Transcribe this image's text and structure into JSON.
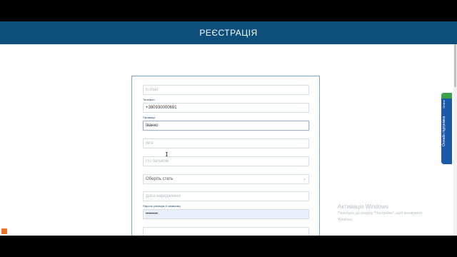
{
  "header": {
    "title": "РЕЄСТРАЦІЯ"
  },
  "form": {
    "email": {
      "placeholder": "E-mail",
      "value": ""
    },
    "phone": {
      "label": "Телефон",
      "value": "+380930000691"
    },
    "surname": {
      "label": "Прізвище",
      "value": "Іванко"
    },
    "name": {
      "placeholder": "Ім'я",
      "value": ""
    },
    "patronymic": {
      "placeholder": "По батькові",
      "value": ""
    },
    "gender": {
      "selected": "Оберіть стать"
    },
    "birthdate": {
      "placeholder": "Дата народження",
      "value": ""
    },
    "password": {
      "label": "Пароль (мінімум 6 символів)",
      "value": "••••••••"
    }
  },
  "support": {
    "label": "Онлайн підтримка",
    "status": "Online"
  },
  "watermark": {
    "title": "Активація Windows",
    "line1": "Перейдіть до розділу \"Настройки\", щоб активувати",
    "line2": "Windows."
  },
  "icons": {
    "chevron": "chevron-down-icon",
    "cursor": "text-cursor-icon"
  }
}
